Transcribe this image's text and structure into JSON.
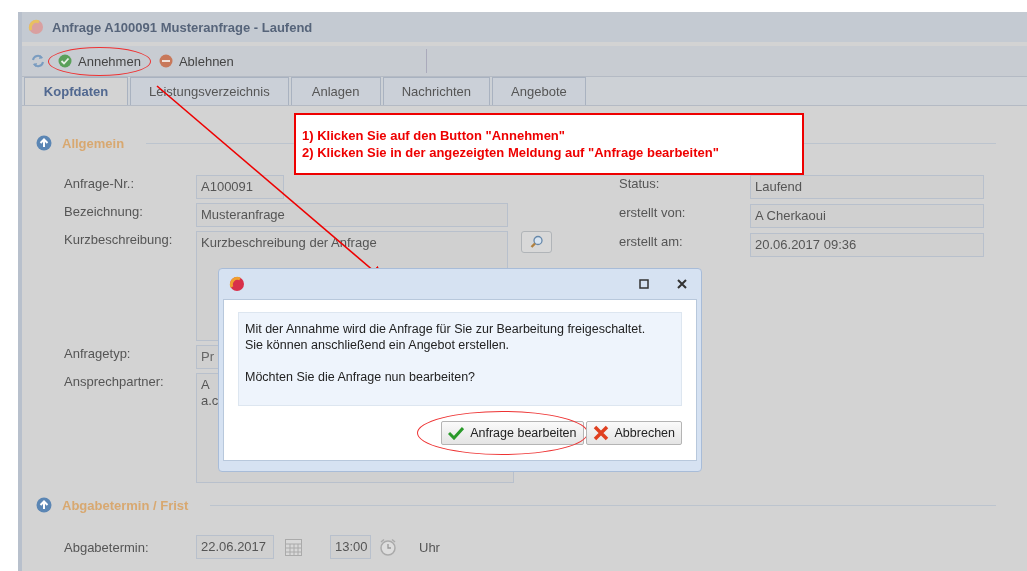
{
  "window": {
    "title": "Anfrage A100091 Musteranfrage - Laufend"
  },
  "toolbar": {
    "buttons": [
      {
        "label": "Annehmen",
        "kind": "accept",
        "circled": true
      },
      {
        "label": "Ablehnen",
        "kind": "reject",
        "circled": false
      }
    ]
  },
  "tabs": [
    {
      "label": "Kopfdaten",
      "selected": true
    },
    {
      "label": "Leistungsverzeichnis",
      "selected": false
    },
    {
      "label": "Anlagen",
      "selected": false
    },
    {
      "label": "Nachrichten",
      "selected": false
    },
    {
      "label": "Angebote",
      "selected": false
    }
  ],
  "annotation": {
    "lines": [
      "1) Klicken Sie auf den Button \"Annehmen\"",
      "2) Klicken Sie in der angezeigten Meldung auf \"Anfrage bearbeiten\""
    ]
  },
  "general": {
    "title": "Allgemein",
    "left_fields": [
      {
        "label": "Anfrage-Nr.:",
        "value": "A100091",
        "kind": "short"
      },
      {
        "label": "Bezeichnung:",
        "value": "Musteranfrage",
        "kind": "text"
      },
      {
        "label": "Kurzbeschreibung:",
        "value": "Kurzbeschreibung der Anfrage",
        "kind": "textarea_search"
      },
      {
        "label": "Anfragetyp:",
        "value": "Pr",
        "kind": "select"
      },
      {
        "label": "Ansprechpartner:",
        "value": "A\na.c",
        "kind": "textarea"
      }
    ],
    "right_fields": [
      {
        "label": "Status:",
        "value": "Laufend"
      },
      {
        "label": "erstellt von:",
        "value": "A Cherkaoui"
      },
      {
        "label": "erstellt am:",
        "value": "20.06.2017 09:36"
      }
    ]
  },
  "deadline": {
    "title": "Abgabetermin / Frist",
    "label": "Abgabetermin:",
    "date": "22.06.2017",
    "time": "13:00",
    "unit": "Uhr"
  },
  "dialog": {
    "message": "Mit der Annahme wird die Anfrage für Sie zur Bearbeitung freigeschaltet.\nSie können anschließend ein Angebot erstellen.\n\nMöchten Sie die Anfrage nun bearbeiten?",
    "buttons": [
      {
        "label": "Anfrage bearbeiten",
        "kind": "confirm",
        "circled": true
      },
      {
        "label": "Abbrechen",
        "kind": "cancel",
        "circled": false
      }
    ]
  }
}
